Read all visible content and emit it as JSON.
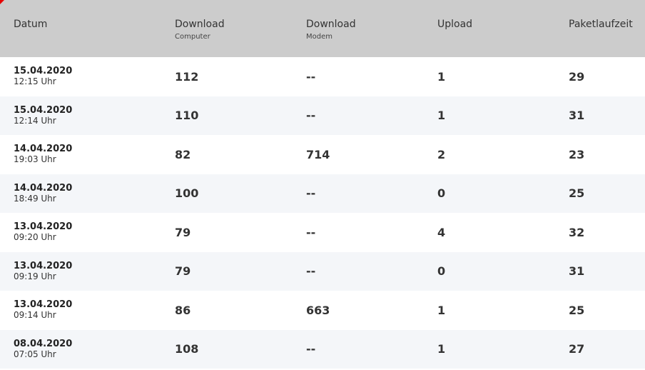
{
  "header": {
    "datum": "Datum",
    "download_computer": {
      "label": "Download",
      "sub": "Computer"
    },
    "download_modem": {
      "label": "Download",
      "sub": "Modem"
    },
    "upload": "Upload",
    "paketlaufzeit": "Paketlaufzeit"
  },
  "rows": [
    {
      "date": "15.04.2020",
      "time": "12:15 Uhr",
      "dl_computer": "112",
      "dl_modem": "--",
      "upload": "1",
      "ping": "29"
    },
    {
      "date": "15.04.2020",
      "time": "12:14 Uhr",
      "dl_computer": "110",
      "dl_modem": "--",
      "upload": "1",
      "ping": "31"
    },
    {
      "date": "14.04.2020",
      "time": "19:03 Uhr",
      "dl_computer": "82",
      "dl_modem": "714",
      "upload": "2",
      "ping": "23"
    },
    {
      "date": "14.04.2020",
      "time": "18:49 Uhr",
      "dl_computer": "100",
      "dl_modem": "--",
      "upload": "0",
      "ping": "25"
    },
    {
      "date": "13.04.2020",
      "time": "09:20 Uhr",
      "dl_computer": "79",
      "dl_modem": "--",
      "upload": "4",
      "ping": "32"
    },
    {
      "date": "13.04.2020",
      "time": "09:19 Uhr",
      "dl_computer": "79",
      "dl_modem": "--",
      "upload": "0",
      "ping": "31"
    },
    {
      "date": "13.04.2020",
      "time": "09:14 Uhr",
      "dl_computer": "86",
      "dl_modem": "663",
      "upload": "1",
      "ping": "25"
    },
    {
      "date": "08.04.2020",
      "time": "07:05 Uhr",
      "dl_computer": "108",
      "dl_modem": "--",
      "upload": "1",
      "ping": "27"
    }
  ],
  "colors": {
    "header_bg": "#cccccc",
    "row_alt_bg": "#f4f6f9",
    "accent": "#e60000"
  }
}
